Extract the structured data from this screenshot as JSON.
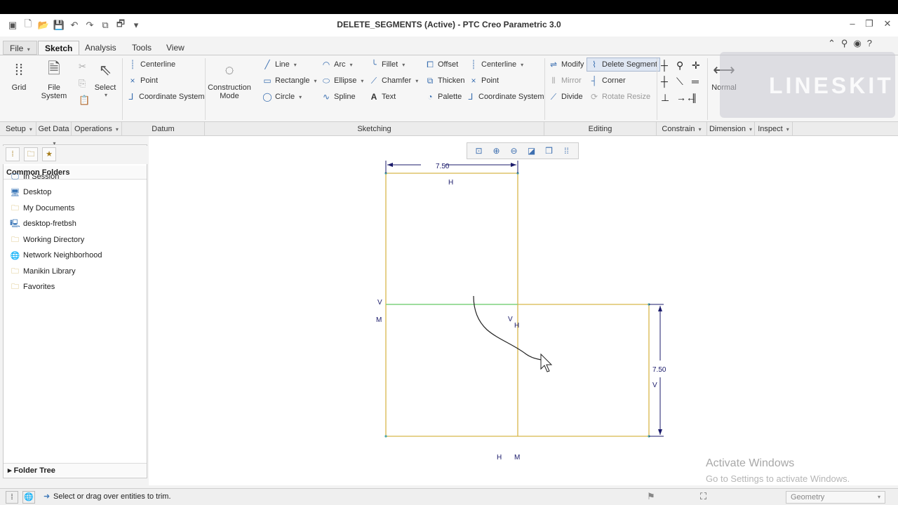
{
  "window": {
    "title": "DELETE_SEGMENTS (Active) - PTC Creo Parametric 3.0"
  },
  "tabs": [
    {
      "label": "File"
    },
    {
      "label": "Sketch"
    },
    {
      "label": "Analysis"
    },
    {
      "label": "Tools"
    },
    {
      "label": "View"
    }
  ],
  "ribbon": {
    "grid": "Grid",
    "file_system_1": "File",
    "file_system_2": "System",
    "select": "Select",
    "datum": {
      "centerline": "Centerline",
      "point": "Point",
      "coord": "Coordinate System"
    },
    "construction_1": "Construction",
    "construction_2": "Mode",
    "sketching": {
      "line": "Line",
      "rectangle": "Rectangle",
      "circle": "Circle",
      "arc": "Arc",
      "ellipse": "Ellipse",
      "spline": "Spline",
      "fillet": "Fillet",
      "chamfer": "Chamfer",
      "text": "Text",
      "offset": "Offset",
      "thicken": "Thicken",
      "palette": "Palette",
      "centerline": "Centerline",
      "point": "Point",
      "coord": "Coordinate System"
    },
    "editing": {
      "modify": "Modify",
      "delete_segment": "Delete Segment",
      "mirror": "Mirror",
      "corner": "Corner",
      "divide": "Divide",
      "rotate_resize": "Rotate Resize"
    },
    "normal": "Normal"
  },
  "groups": {
    "setup": "Setup",
    "get_data": "Get Data",
    "operations": "Operations",
    "datum": "Datum",
    "sketching": "Sketching",
    "editing": "Editing",
    "constrain": "Constrain",
    "dimension": "Dimension",
    "inspect": "Inspect"
  },
  "watermark": "LINESKIT",
  "navigator": {
    "header": "Common Folders",
    "folders": [
      {
        "label": "In Session",
        "icon": "monitor-icon"
      },
      {
        "label": "Desktop",
        "icon": "desktop-icon"
      },
      {
        "label": "My Documents",
        "icon": "documents-icon"
      },
      {
        "label": "desktop-fretbsh",
        "icon": "computer-icon"
      },
      {
        "label": "Working Directory",
        "icon": "folder-icon"
      },
      {
        "label": "Network Neighborhood",
        "icon": "network-icon"
      },
      {
        "label": "Manikin Library",
        "icon": "library-icon"
      },
      {
        "label": "Favorites",
        "icon": "favorites-icon"
      }
    ],
    "folder_tree": "Folder Tree"
  },
  "sketch": {
    "dim_top": "7.50",
    "dim_right": "7.50",
    "c_h_top": "H",
    "c_v_left": "V",
    "c_m_left": "M",
    "c_v_mid": "V",
    "c_h_mid": "H",
    "c_v_right": "V",
    "c_h_bottom": "H",
    "c_m_bottom": "M"
  },
  "activate": {
    "line1": "Activate Windows",
    "line2": "Go to Settings to activate Windows."
  },
  "status": {
    "message": "Select or drag over entities to trim.",
    "filter": "Geometry"
  },
  "colors": {
    "sketch_line": "#d8b64a",
    "highlight_line": "#7fd27f",
    "dimension": "#1b1b6b"
  }
}
